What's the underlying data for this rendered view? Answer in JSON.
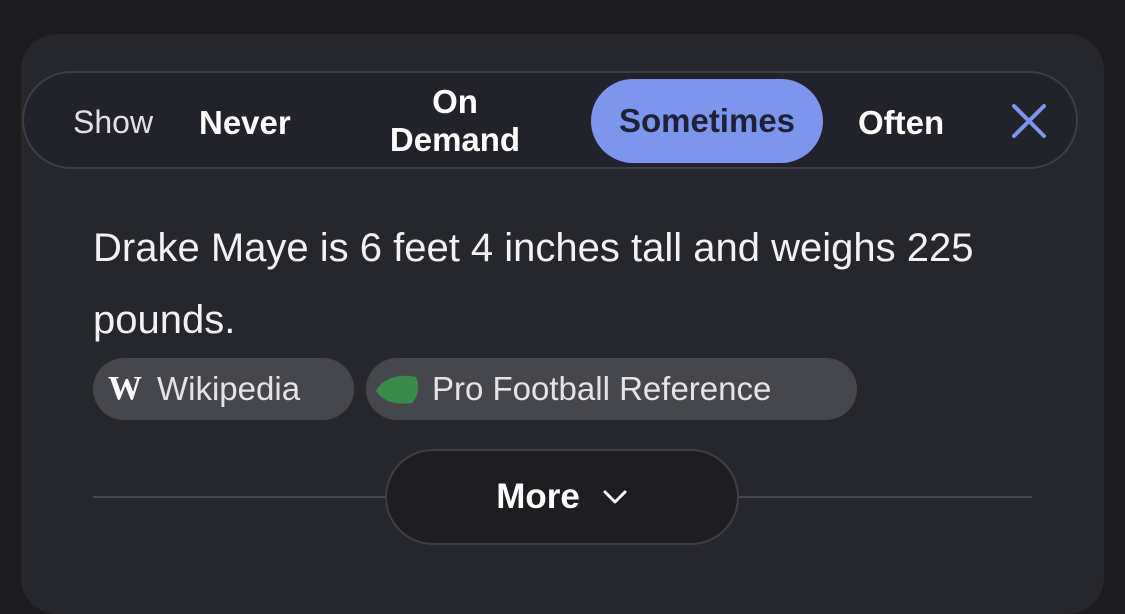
{
  "toolbar": {
    "show_label": "Show",
    "options": [
      {
        "label": "Never",
        "selected": false
      },
      {
        "label": "On Demand",
        "lines": [
          "On",
          "Demand"
        ],
        "selected": false
      },
      {
        "label": "Sometimes",
        "selected": true
      },
      {
        "label": "Often",
        "selected": false
      }
    ],
    "close_icon": "close-icon"
  },
  "answer": {
    "text": "Drake Maye is 6 feet 4 inches tall and weighs 225 pounds."
  },
  "sources": [
    {
      "label": "Wikipedia",
      "icon": "wikipedia-logo-icon",
      "logo_text": "W"
    },
    {
      "label": "Pro Football Reference",
      "icon": "pro-football-reference-logo-icon"
    }
  ],
  "more_button": {
    "label": "More",
    "icon": "chevron-down-icon"
  },
  "colors": {
    "page_bg": "#1c1c1e",
    "card_bg": "#26272c",
    "accent": "#7c96ee",
    "chip_bg": "#46474c",
    "pfr_green": "#3a8a4a"
  }
}
